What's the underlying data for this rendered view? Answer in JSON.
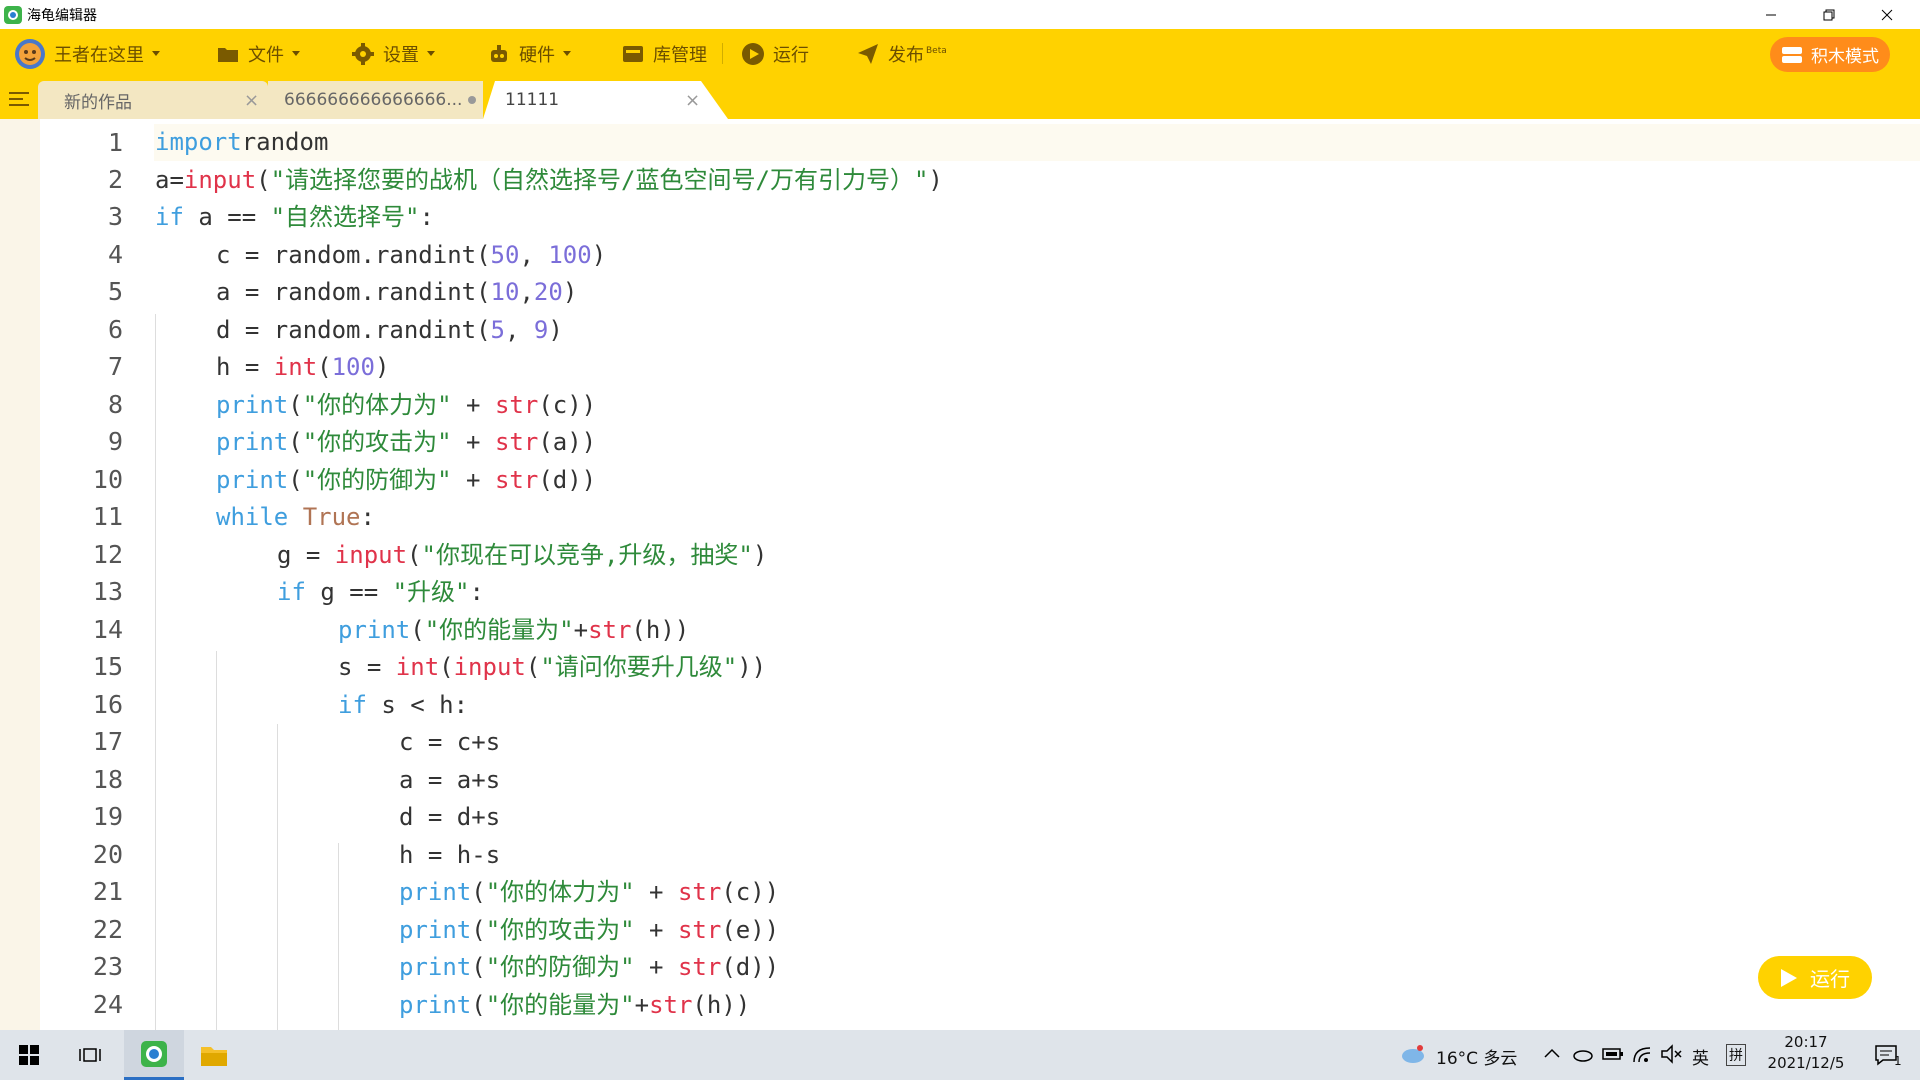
{
  "window": {
    "title": "海龟编辑器"
  },
  "toolbar": {
    "user": "王者在这里",
    "file": "文件",
    "settings": "设置",
    "hardware": "硬件",
    "library": "库管理",
    "run": "运行",
    "publish": "发布",
    "publish_badge": "Beta",
    "mode": "积木模式"
  },
  "tabs": [
    {
      "label": "新的作品",
      "state": "closable"
    },
    {
      "label": "666666666666666...",
      "state": "unsaved"
    },
    {
      "label": "11111",
      "state": "active"
    }
  ],
  "editor": {
    "line_numbers": [
      "1",
      "2",
      "3",
      "4",
      "5",
      "6",
      "7",
      "8",
      "9",
      "10",
      "11",
      "12",
      "13",
      "14",
      "15",
      "16",
      "17",
      "18",
      "19",
      "20",
      "21",
      "22",
      "23",
      "24"
    ],
    "run_button": "运行"
  },
  "taskbar": {
    "weather": "16°C 多云",
    "ime_lang": "英",
    "ime_mode": "拼",
    "time": "20:17",
    "date": "2021/12/5",
    "notifications": "1"
  },
  "colors": {
    "toolbar_bg": "#ffd200",
    "mode_button": "#ff8c1a",
    "keyword": "#3f9ede",
    "builtin": "#e0334a",
    "number": "#7b6ed9",
    "string": "#2e8a3a"
  }
}
